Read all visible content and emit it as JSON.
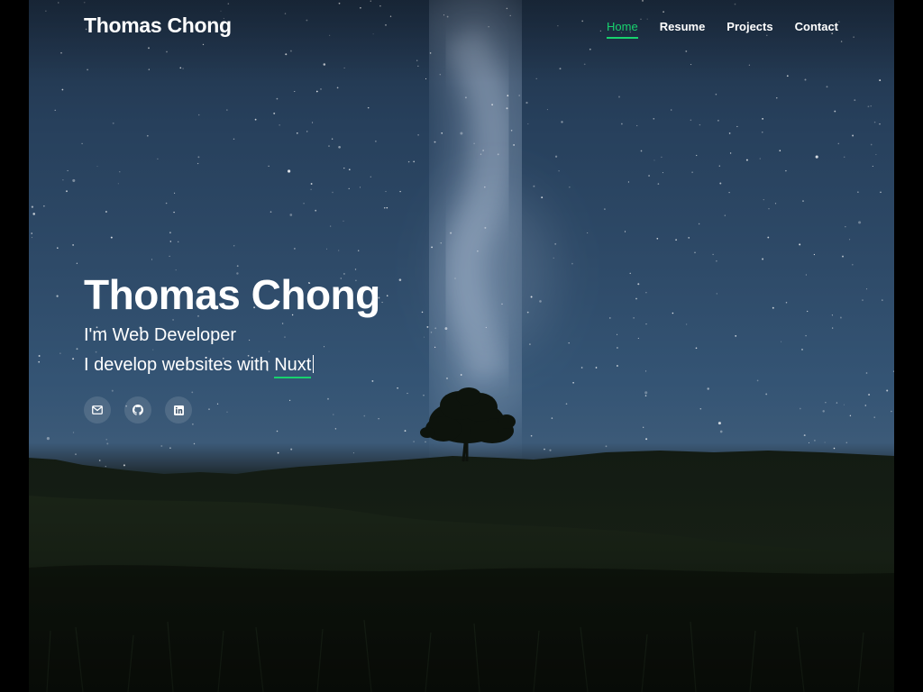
{
  "header": {
    "logo": "Thomas Chong",
    "nav": [
      {
        "label": "Home",
        "active": true
      },
      {
        "label": "Resume",
        "active": false
      },
      {
        "label": "Projects",
        "active": false
      },
      {
        "label": "Contact",
        "active": false
      }
    ]
  },
  "hero": {
    "title": "Thomas Chong",
    "subtitle": "I'm Web Developer",
    "tagline_prefix": "I develop websites with",
    "tagline_typed": "Nuxt",
    "social": [
      {
        "name": "email",
        "icon": "envelope-icon"
      },
      {
        "name": "github",
        "icon": "github-icon"
      },
      {
        "name": "linkedin",
        "icon": "linkedin-icon"
      }
    ]
  },
  "colors": {
    "accent": "#18d26e",
    "text": "#ffffff",
    "sky": "#2e4a68",
    "ground": "#0f160f"
  }
}
